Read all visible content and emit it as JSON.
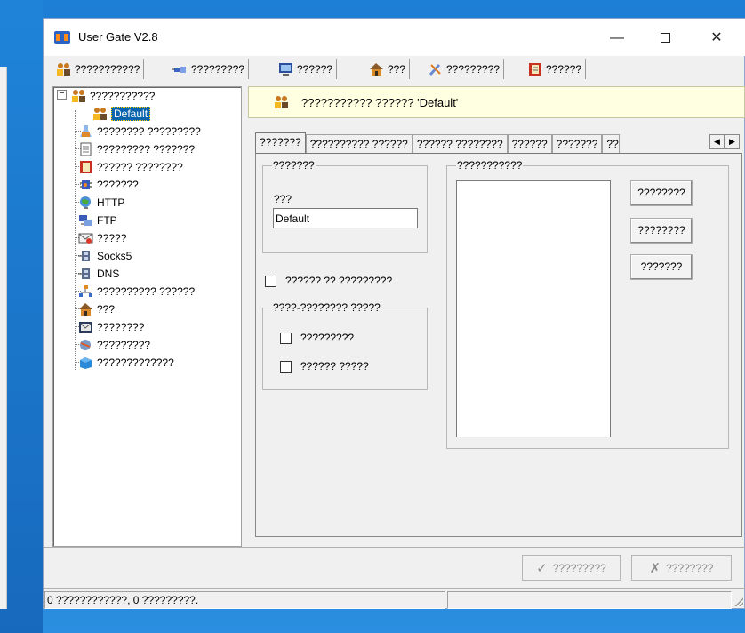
{
  "window": {
    "title": "User Gate V2.8"
  },
  "toolbar": {
    "items": [
      {
        "label": "???????????",
        "icon": "users-icon"
      },
      {
        "label": "?????????",
        "icon": "plug-icon"
      },
      {
        "label": "??????",
        "icon": "monitor-icon"
      },
      {
        "label": "???",
        "icon": "house-icon"
      },
      {
        "label": "?????????",
        "icon": "tools-icon"
      },
      {
        "label": "??????",
        "icon": "book-icon"
      }
    ]
  },
  "tree": {
    "root": {
      "label": "???????????",
      "icon": "users-icon"
    },
    "selected_child": {
      "label": "Default",
      "icon": "users-icon"
    },
    "items": [
      {
        "label": "???????? ?????????",
        "icon": "flask-icon"
      },
      {
        "label": "????????? ???????",
        "icon": "document-icon"
      },
      {
        "label": "?????? ????????",
        "icon": "book-icon"
      },
      {
        "label": "???????",
        "icon": "chip-icon"
      },
      {
        "label": "HTTP",
        "icon": "globe-icon"
      },
      {
        "label": "FTP",
        "icon": "network-icon"
      },
      {
        "label": "?????",
        "icon": "mail-icon"
      },
      {
        "label": "Socks5",
        "icon": "socket-icon"
      },
      {
        "label": "DNS",
        "icon": "socket-icon"
      },
      {
        "label": "?????????? ??????",
        "icon": "sitemap-icon"
      },
      {
        "label": "???",
        "icon": "house-icon"
      },
      {
        "label": "????????",
        "icon": "envelope-icon"
      },
      {
        "label": "?????????",
        "icon": "globe-icon"
      },
      {
        "label": "?????????????",
        "icon": "box-icon"
      }
    ]
  },
  "header": {
    "text": "??????????? ?????? 'Default'"
  },
  "tabs": [
    {
      "label": "???????",
      "active": true
    },
    {
      "label": "?????????? ??????",
      "active": false
    },
    {
      "label": "?????? ????????",
      "active": false
    },
    {
      "label": "??????",
      "active": false
    },
    {
      "label": "???????",
      "active": false
    },
    {
      "label": "??",
      "active": false
    }
  ],
  "general": {
    "group_title": "???????",
    "name_label": "???",
    "name_value": "Default",
    "checkbox_label": "?????? ?? ?????????",
    "checkbox_checked": false,
    "subgroup_title": "????-???????? ?????",
    "option1_label": "?????????",
    "option1_checked": false,
    "option2_label": "?????? ?????",
    "option2_checked": false
  },
  "members": {
    "group_title": "???????????",
    "add_button": "????????",
    "edit_button": "????????",
    "remove_button": "???????"
  },
  "footer": {
    "apply_button": "?????????",
    "cancel_button": "????????"
  },
  "status": {
    "text": "0 ????????????, 0 ?????????."
  }
}
